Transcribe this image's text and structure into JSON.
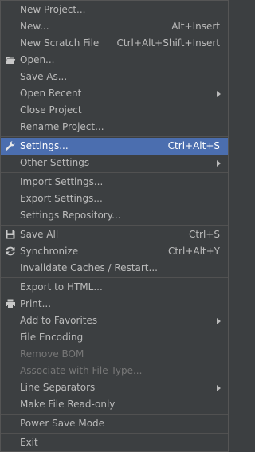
{
  "colors": {
    "background": "#3c3f41",
    "text": "#bbbbbb",
    "selected_bg": "#4b6eaf",
    "disabled_text": "#777777",
    "separator": "#515151"
  },
  "menu": {
    "new_project": "New Project...",
    "new": "New...",
    "new_shortcut": "Alt+Insert",
    "new_scratch_file": "New Scratch File",
    "new_scratch_file_shortcut": "Ctrl+Alt+Shift+Insert",
    "open": "Open...",
    "save_as": "Save As...",
    "open_recent": "Open Recent",
    "close_project": "Close Project",
    "rename_project": "Rename Project...",
    "settings": "Settings...",
    "settings_shortcut": "Ctrl+Alt+S",
    "other_settings": "Other Settings",
    "import_settings": "Import Settings...",
    "export_settings": "Export Settings...",
    "settings_repository": "Settings Repository...",
    "save_all": "Save All",
    "save_all_shortcut": "Ctrl+S",
    "synchronize": "Synchronize",
    "synchronize_shortcut": "Ctrl+Alt+Y",
    "invalidate_caches": "Invalidate Caches / Restart...",
    "export_to_html": "Export to HTML...",
    "print": "Print...",
    "add_to_favorites": "Add to Favorites",
    "file_encoding": "File Encoding",
    "remove_bom": "Remove BOM",
    "associate_with_file_type": "Associate with File Type...",
    "line_separators": "Line Separators",
    "make_file_read_only": "Make File Read-only",
    "power_save_mode": "Power Save Mode",
    "exit": "Exit"
  },
  "icons": {
    "open": "folder-icon",
    "settings": "wrench-icon",
    "save_all": "floppy-disk-icon",
    "synchronize": "sync-icon",
    "print": "printer-icon",
    "submenu": "chevron-right-icon"
  }
}
